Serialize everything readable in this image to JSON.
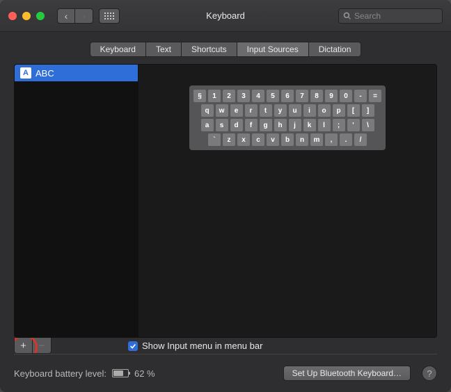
{
  "window": {
    "title": "Keyboard"
  },
  "search": {
    "placeholder": "Search"
  },
  "tabs": [
    {
      "label": "Keyboard",
      "active": false
    },
    {
      "label": "Text",
      "active": false
    },
    {
      "label": "Shortcuts",
      "active": false
    },
    {
      "label": "Input Sources",
      "active": true
    },
    {
      "label": "Dictation",
      "active": false
    }
  ],
  "sources": [
    {
      "icon": "A",
      "name": "ABC",
      "selected": true
    }
  ],
  "keyboard_rows": [
    [
      "§",
      "1",
      "2",
      "3",
      "4",
      "5",
      "6",
      "7",
      "8",
      "9",
      "0",
      "-",
      "="
    ],
    [
      "q",
      "w",
      "e",
      "r",
      "t",
      "y",
      "u",
      "i",
      "o",
      "p",
      "[",
      "]"
    ],
    [
      "a",
      "s",
      "d",
      "f",
      "g",
      "h",
      "j",
      "k",
      "l",
      ";",
      "'",
      "\\"
    ],
    [
      "`",
      "z",
      "x",
      "c",
      "v",
      "b",
      "n",
      "m",
      ",",
      ".",
      "/"
    ]
  ],
  "menubar_check": {
    "label": "Show Input menu in menu bar",
    "checked": true
  },
  "add_remove": {
    "add": "+",
    "remove": "−"
  },
  "battery": {
    "label": "Keyboard battery level:",
    "percent": "62 %",
    "fill_pct": 62
  },
  "bluetooth_button": "Set Up Bluetooth Keyboard…",
  "help": "?"
}
